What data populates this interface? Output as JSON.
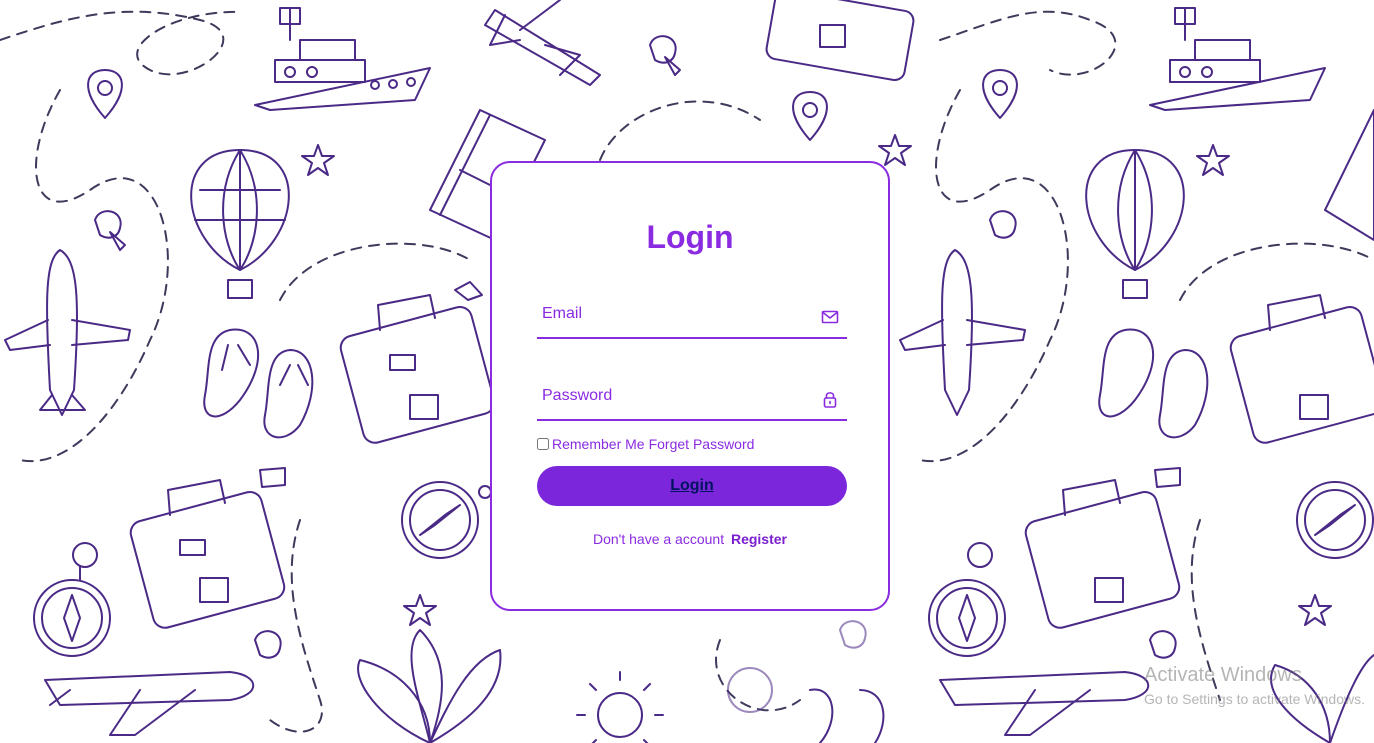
{
  "login": {
    "title": "Login",
    "email_placeholder": "Email",
    "password_placeholder": "Password",
    "remember_label": "Remember Me",
    "forget_label": "Forget Password",
    "button_label": "Login",
    "register_prompt": "Don't have a account",
    "register_link": "Register",
    "email_icon": "envelope-icon",
    "password_icon": "lock-icon"
  },
  "watermark": {
    "title": "Activate Windows",
    "subtitle": "Go to Settings to activate Windows."
  },
  "background": {
    "pattern": "travel doodles: airplanes, ships, hot air balloons, suitcases, compasses, location pins, flip-flops, palm leaves, sun, stars, dashed travel routes"
  },
  "colors": {
    "accent": "#8a2be2",
    "button": "#7c26db",
    "doodle": "#4a2a86"
  }
}
